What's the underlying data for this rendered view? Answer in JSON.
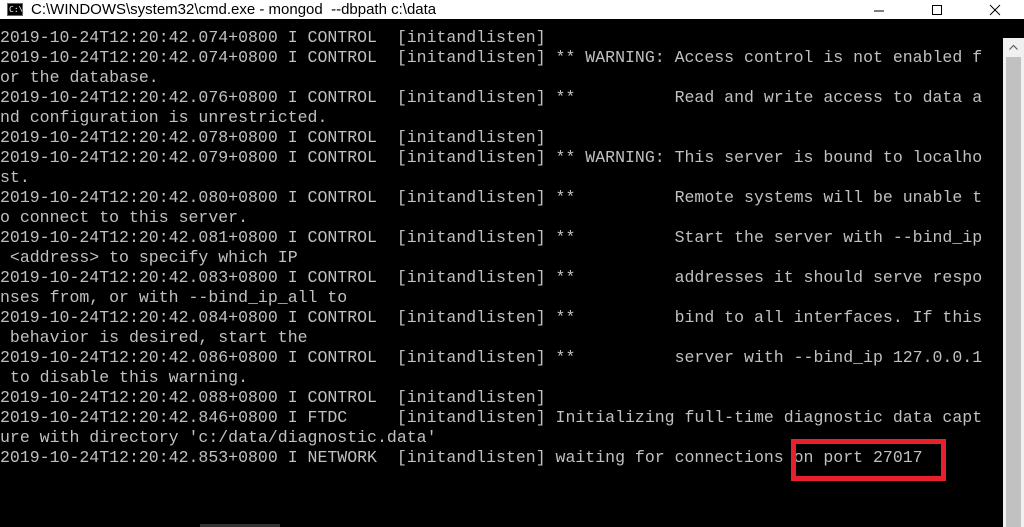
{
  "window": {
    "title": "C:\\WINDOWS\\system32\\cmd.exe - mongod  --dbpath c:\\data",
    "icon": "cmd-icon",
    "icon_text": "C:\\",
    "controls": [
      "minimize-icon",
      "maximize-icon",
      "close-icon"
    ]
  },
  "console": {
    "lines": [
      "2019-10-24T12:20:42.074+0800 I CONTROL  [initandlisten]",
      "2019-10-24T12:20:42.074+0800 I CONTROL  [initandlisten] ** WARNING: Access control is not enabled f",
      "or the database.",
      "2019-10-24T12:20:42.076+0800 I CONTROL  [initandlisten] **          Read and write access to data a",
      "nd configuration is unrestricted.",
      "2019-10-24T12:20:42.078+0800 I CONTROL  [initandlisten]",
      "2019-10-24T12:20:42.079+0800 I CONTROL  [initandlisten] ** WARNING: This server is bound to localho",
      "st.",
      "2019-10-24T12:20:42.080+0800 I CONTROL  [initandlisten] **          Remote systems will be unable t",
      "o connect to this server.",
      "2019-10-24T12:20:42.081+0800 I CONTROL  [initandlisten] **          Start the server with --bind_ip",
      " <address> to specify which IP",
      "2019-10-24T12:20:42.083+0800 I CONTROL  [initandlisten] **          addresses it should serve respo",
      "nses from, or with --bind_ip_all to",
      "2019-10-24T12:20:42.084+0800 I CONTROL  [initandlisten] **          bind to all interfaces. If this",
      " behavior is desired, start the",
      "2019-10-24T12:20:42.086+0800 I CONTROL  [initandlisten] **          server with --bind_ip 127.0.0.1",
      " to disable this warning.",
      "2019-10-24T12:20:42.088+0800 I CONTROL  [initandlisten]",
      "2019-10-24T12:20:42.846+0800 I FTDC     [initandlisten] Initializing full-time diagnostic data capt",
      "ure with directory 'c:/data/diagnostic.data'",
      "2019-10-24T12:20:42.853+0800 I NETWORK  [initandlisten] waiting for connections on port 27017"
    ]
  },
  "colors": {
    "console_bg": "#000000",
    "console_text": "#c0c0c0",
    "highlight": "#e8202a"
  }
}
